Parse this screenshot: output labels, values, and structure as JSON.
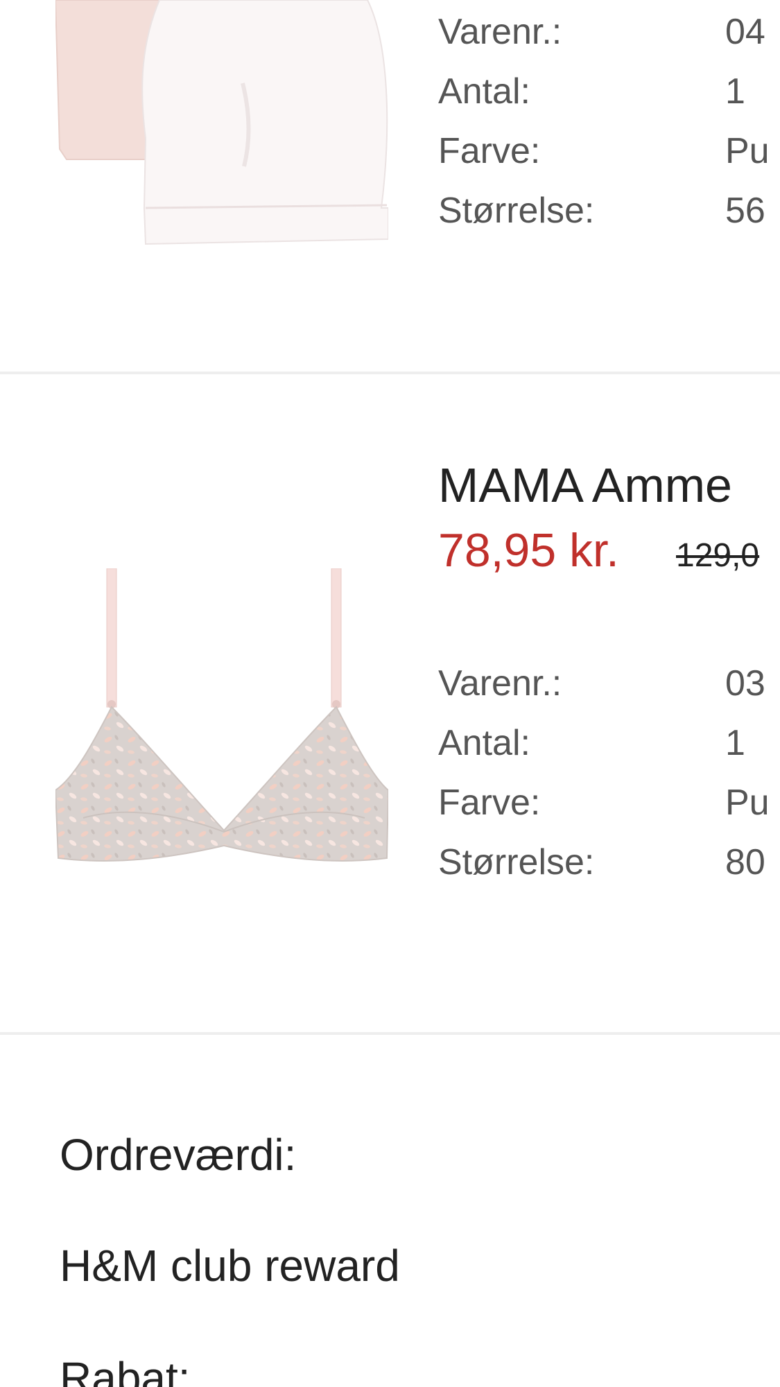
{
  "items": [
    {
      "image_icon": "beanie-hats-image",
      "details": [
        {
          "label": "Varenr.:",
          "value": "04"
        },
        {
          "label": "Antal:",
          "value": "1"
        },
        {
          "label": "Farve:",
          "value": "Pu"
        },
        {
          "label": "Størrelse:",
          "value": "56"
        }
      ]
    },
    {
      "image_icon": "nursing-bra-image",
      "title": "MAMA Amme",
      "price_sale": "78,95 kr.",
      "price_original": "129,0",
      "details": [
        {
          "label": "Varenr.:",
          "value": "03"
        },
        {
          "label": "Antal:",
          "value": "1"
        },
        {
          "label": "Farve:",
          "value": "Pu"
        },
        {
          "label": "Størrelse:",
          "value": "80"
        }
      ]
    }
  ],
  "summary": {
    "order_value_label": "Ordreværdi:",
    "club_reward_label": "H&M club reward",
    "discount_label": "Rabat:"
  },
  "colors": {
    "sale_price": "#c0302b",
    "divider": "#eeeeee",
    "label_text": "#555555",
    "main_text": "#222222"
  }
}
